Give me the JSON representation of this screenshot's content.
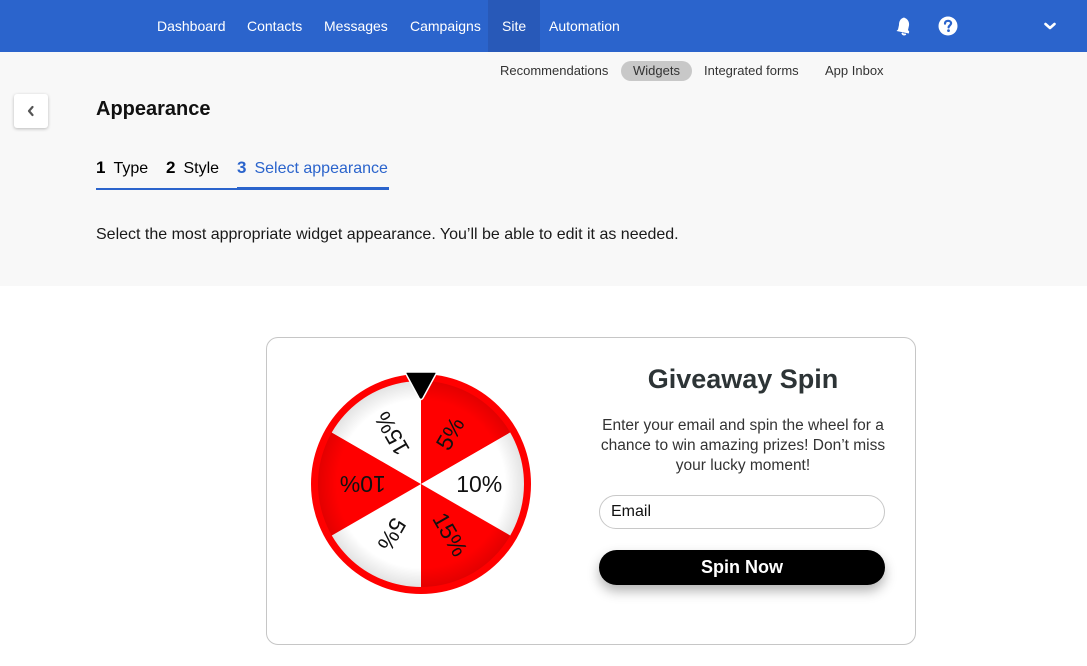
{
  "topnav": {
    "items": [
      {
        "label": "Dashboard",
        "active": false
      },
      {
        "label": "Contacts",
        "active": false
      },
      {
        "label": "Messages",
        "active": false
      },
      {
        "label": "Campaigns",
        "active": false
      },
      {
        "label": "Site",
        "active": true
      },
      {
        "label": "Automation",
        "active": false
      }
    ],
    "icons": [
      "bell-icon",
      "help-icon",
      "chevron-down-icon"
    ],
    "bg_color": "#2b64cc"
  },
  "subnav": {
    "items": [
      {
        "label": "Recommendations",
        "active": false
      },
      {
        "label": "Widgets",
        "active": true
      },
      {
        "label": "Integrated forms",
        "active": false
      },
      {
        "label": "App Inbox",
        "active": false
      }
    ]
  },
  "page": {
    "title": "Appearance",
    "back_icon": "chevron-left-icon",
    "steps": [
      {
        "number": "1",
        "label": "Type",
        "current": false
      },
      {
        "number": "2",
        "label": "Style",
        "current": false
      },
      {
        "number": "3",
        "label": "Select appearance",
        "current": true
      }
    ],
    "intro": "Select the most appropriate widget appearance. You’ll be able to edit it as needed."
  },
  "widget": {
    "title": "Giveaway Spin",
    "description": "Enter your email and spin the wheel for a chance to win amazing prizes! Don’t miss your lucky moment!",
    "email_placeholder": "Email",
    "button_label": "Spin Now",
    "wheel": {
      "segments": [
        {
          "label": "5%",
          "color": "#ff0000"
        },
        {
          "label": "10%",
          "color": "#ffffff"
        },
        {
          "label": "15%",
          "color": "#ff0000"
        },
        {
          "label": "5%",
          "color": "#ffffff"
        },
        {
          "label": "10%",
          "color": "#ff0000"
        },
        {
          "label": "15%",
          "color": "#ffffff"
        }
      ],
      "rim_color": "#ff0000",
      "pointer_color": "#000000"
    }
  }
}
